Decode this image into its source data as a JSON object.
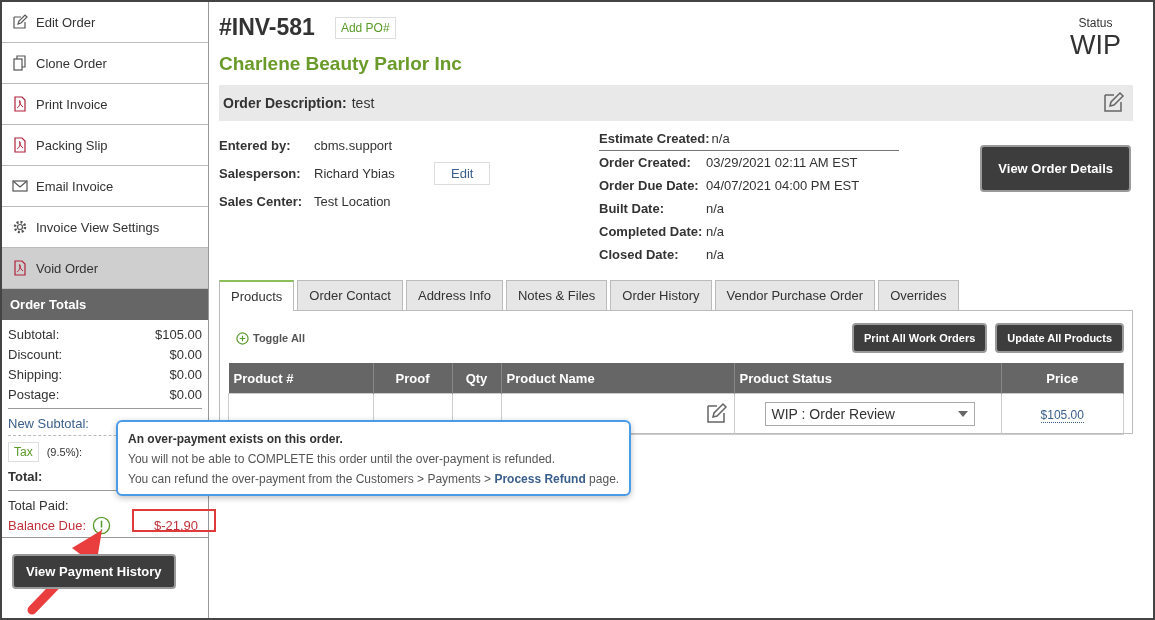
{
  "sidebar": {
    "actions": [
      {
        "label": "Edit Order",
        "kind": "edit",
        "selected": false
      },
      {
        "label": "Clone Order",
        "kind": "copy",
        "selected": false
      },
      {
        "label": "Print Invoice",
        "kind": "pdf",
        "selected": false
      },
      {
        "label": "Packing Slip",
        "kind": "pdf",
        "selected": false
      },
      {
        "label": "Email Invoice",
        "kind": "mail",
        "selected": false
      },
      {
        "label": "Invoice View Settings",
        "kind": "gear",
        "selected": false
      },
      {
        "label": "Void Order",
        "kind": "pdf",
        "selected": true
      }
    ],
    "totals": {
      "title": "Order Totals",
      "rows": [
        {
          "label": "Subtotal:",
          "value": "$105.00"
        },
        {
          "label": "Discount:",
          "value": "$0.00"
        },
        {
          "label": "Shipping:",
          "value": "$0.00"
        },
        {
          "label": "Postage:",
          "value": "$0.00"
        }
      ],
      "new_subtotal": "New Subtotal:",
      "tax_button": "Tax",
      "tax_rate": "(9.5%):",
      "total": "Total:",
      "total_paid": "Total Paid:",
      "balance_label": "Balance Due:",
      "balance_value": "$-21.90"
    },
    "history_button": "View Payment History"
  },
  "order": {
    "number": "#INV-581",
    "add_po": "Add PO#",
    "customer": "Charlene Beauty Parlor Inc",
    "status_label": "Status",
    "status": "WIP",
    "description_label": "Order Description:",
    "description": "test",
    "people": [
      {
        "label": "Entered by:",
        "value": "cbms.support"
      },
      {
        "label": "Salesperson:",
        "value": "Richard Ybias",
        "edit": "Edit"
      },
      {
        "label": "Sales Center:",
        "value": "Test Location"
      }
    ],
    "estimate": {
      "label": "Estimate Created:",
      "value": "n/a"
    },
    "dates": [
      {
        "label": "Order Created:",
        "value": "03/29/2021 02:11 AM EST"
      },
      {
        "label": "Order Due Date:",
        "value": "04/07/2021 04:00 PM EST"
      },
      {
        "label": "Built Date:",
        "value": "n/a"
      },
      {
        "label": "Completed Date:",
        "value": "n/a"
      },
      {
        "label": "Closed Date:",
        "value": "n/a"
      }
    ],
    "details_button": "View Order Details"
  },
  "tabs": [
    {
      "label": "Products",
      "selected": true
    },
    {
      "label": "Order Contact",
      "selected": false
    },
    {
      "label": "Address Info",
      "selected": false
    },
    {
      "label": "Notes & Files",
      "selected": false
    },
    {
      "label": "Order History",
      "selected": false
    },
    {
      "label": "Vendor Purchase Order",
      "selected": false
    },
    {
      "label": "Overrides",
      "selected": false
    }
  ],
  "products": {
    "toggle_all": "Toggle All",
    "buttons": [
      "Print All Work Orders",
      "Update All Products"
    ],
    "columns": [
      "Product #",
      "Proof",
      "Qty",
      "Product Name",
      "Product Status",
      "Price"
    ],
    "rows": [
      {
        "status": "WIP : Order Review",
        "price": "$105.00"
      }
    ]
  },
  "tooltip": {
    "title": "An over-payment exists on this order.",
    "line_1": "You will not be able to COMPLETE this order until the over-payment is refunded.",
    "line_2": "You can refund the over-payment from the Customers > Payments > **Process Refund** page."
  }
}
